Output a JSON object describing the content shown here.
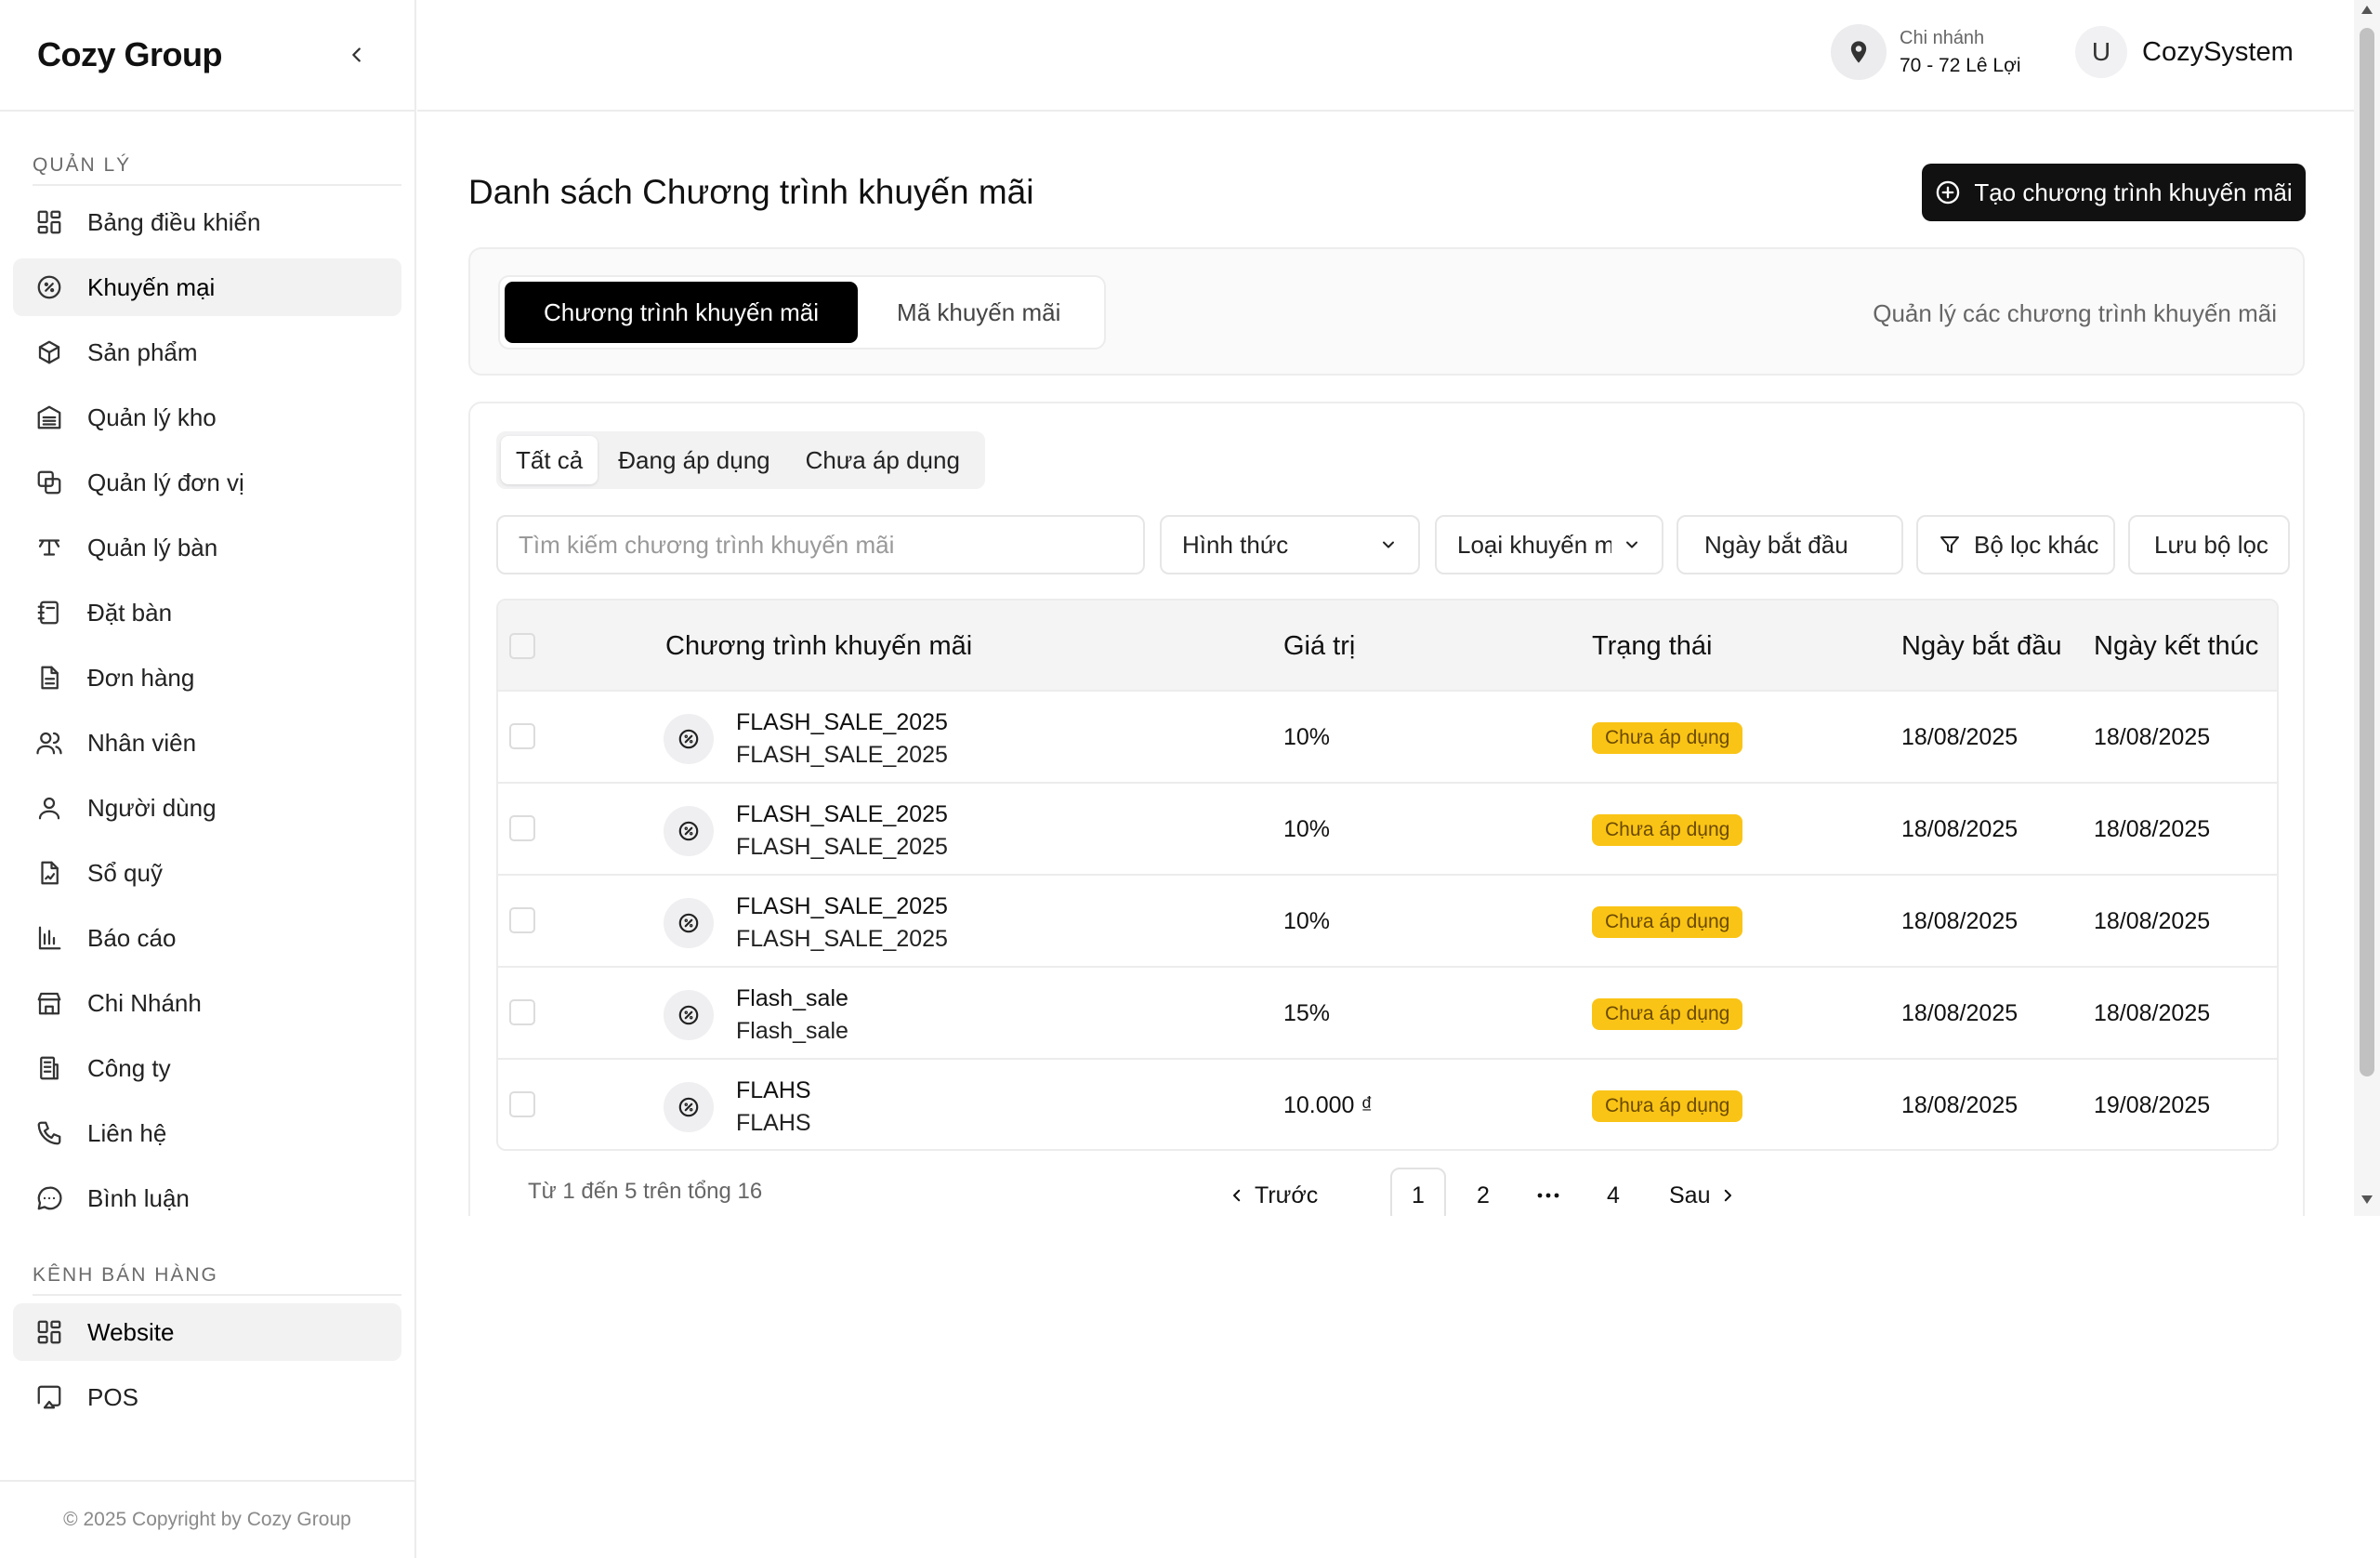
{
  "brand": "Cozy Group",
  "sidebar": {
    "section1": "QUẢN LÝ",
    "items": [
      {
        "label": "Bảng điều khiển",
        "icon": "dashboard-icon"
      },
      {
        "label": "Khuyến mại",
        "icon": "discount-icon"
      },
      {
        "label": "Sản phẩm",
        "icon": "box-icon"
      },
      {
        "label": "Quản lý kho",
        "icon": "warehouse-icon"
      },
      {
        "label": "Quản lý đơn vị",
        "icon": "units-icon"
      },
      {
        "label": "Quản lý bàn",
        "icon": "table-icon"
      },
      {
        "label": "Đặt bàn",
        "icon": "notebook-icon"
      },
      {
        "label": "Đơn hàng",
        "icon": "document-icon"
      },
      {
        "label": "Nhân viên",
        "icon": "users-icon"
      },
      {
        "label": "Người dùng",
        "icon": "user-icon"
      },
      {
        "label": "Sổ quỹ",
        "icon": "ledger-icon"
      },
      {
        "label": "Báo cáo",
        "icon": "chart-icon"
      },
      {
        "label": "Chi Nhánh",
        "icon": "store-icon"
      },
      {
        "label": "Công ty",
        "icon": "building-icon"
      },
      {
        "label": "Liên hệ",
        "icon": "phone-icon"
      },
      {
        "label": "Bình luận",
        "icon": "comment-icon"
      }
    ],
    "section2": "KÊNH BÁN HÀNG",
    "items2": [
      {
        "label": "Website",
        "icon": "grid-icon"
      },
      {
        "label": "POS",
        "icon": "cast-icon"
      }
    ],
    "footer": "© 2025 Copyright by Cozy Group"
  },
  "header": {
    "branch_label": "Chi nhánh",
    "branch_address": "70 - 72 Lê Lợi",
    "avatar_letter": "U",
    "username": "CozySystem"
  },
  "main": {
    "title": "Danh sách Chương trình khuyến mãi",
    "create_label": "Tạo chương trình khuyến mãi",
    "tabs": [
      "Chương trình khuyến mãi",
      "Mã khuyến mãi"
    ],
    "tabs_desc": "Quản lý các chương trình khuyến mãi",
    "filter_tabs": [
      "Tất cả",
      "Đang áp dụng",
      "Chưa áp dụng"
    ],
    "search_placeholder": "Tìm kiếm chương trình khuyến mãi",
    "filter_type": "Hình thức",
    "filter_kind": "Loại khuyến m",
    "filter_date": "Ngày bắt đầu",
    "filter_more": "Bộ lọc khác",
    "save_filter": "Lưu bộ lọc",
    "columns": [
      "Chương trình khuyến mãi",
      "Giá trị",
      "Trạng thái",
      "Ngày bắt đầu",
      "Ngày kết thúc"
    ],
    "rows": [
      {
        "name": "FLASH_SALE_2025",
        "code": "FLASH_SALE_2025",
        "value": "10%",
        "status": "Chưa áp dụng",
        "start": "18/08/2025",
        "end": "18/08/2025"
      },
      {
        "name": "FLASH_SALE_2025",
        "code": "FLASH_SALE_2025",
        "value": "10%",
        "status": "Chưa áp dụng",
        "start": "18/08/2025",
        "end": "18/08/2025"
      },
      {
        "name": "FLASH_SALE_2025",
        "code": "FLASH_SALE_2025",
        "value": "10%",
        "status": "Chưa áp dụng",
        "start": "18/08/2025",
        "end": "18/08/2025"
      },
      {
        "name": "Flash_sale",
        "code": "Flash_sale",
        "value": "15%",
        "status": "Chưa áp dụng",
        "start": "18/08/2025",
        "end": "18/08/2025"
      },
      {
        "name": "FLAHS",
        "code": "FLAHS",
        "value": "10.000 ₫",
        "status": "Chưa áp dụng",
        "start": "18/08/2025",
        "end": "19/08/2025"
      }
    ],
    "pagination": {
      "info": "Từ 1 đến 5 trên tổng 16",
      "prev": "Trước",
      "pages": [
        "1",
        "2",
        "...",
        "4"
      ],
      "current": "1",
      "next": "Sau"
    }
  },
  "colors": {
    "accent": "#000000",
    "badge": "#fac416",
    "active_bg": "#f2f2f3"
  }
}
